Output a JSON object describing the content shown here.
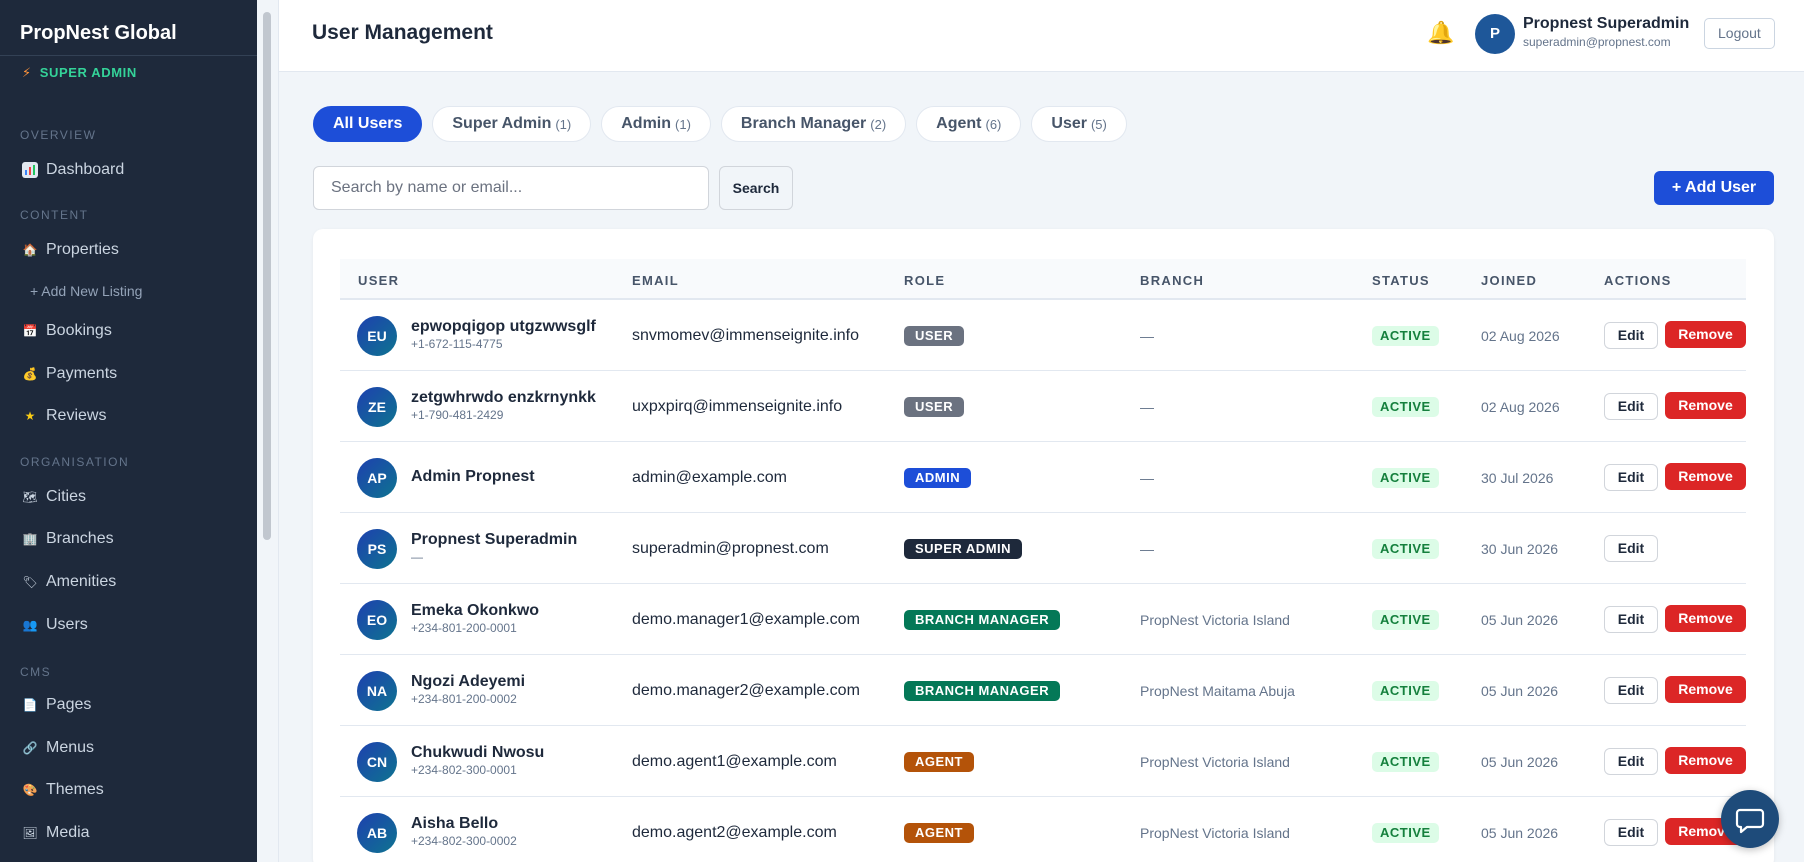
{
  "sidebar": {
    "brand": "PropNest Global",
    "role_tag": "SUPER ADMIN",
    "sections": {
      "overview": "OVERVIEW",
      "content": "CONTENT",
      "organisation": "ORGANISATION",
      "cms": "CMS"
    },
    "items": {
      "dashboard": "Dashboard",
      "properties": "Properties",
      "add_listing": "+ Add New Listing",
      "bookings": "Bookings",
      "payments": "Payments",
      "reviews": "Reviews",
      "cities": "Cities",
      "branches": "Branches",
      "amenities": "Amenities",
      "users": "Users",
      "pages": "Pages",
      "menus": "Menus",
      "themes": "Themes",
      "media": "Media"
    }
  },
  "header": {
    "title": "User Management",
    "user_initial": "P",
    "user_name": "Propnest Superadmin",
    "user_email": "superadmin@propnest.com",
    "logout_label": "Logout"
  },
  "tabs": [
    {
      "label": "All Users",
      "count": ""
    },
    {
      "label": "Super Admin",
      "count": "(1)"
    },
    {
      "label": "Admin",
      "count": "(1)"
    },
    {
      "label": "Branch Manager",
      "count": "(2)"
    },
    {
      "label": "Agent",
      "count": "(6)"
    },
    {
      "label": "User",
      "count": "(5)"
    }
  ],
  "search": {
    "placeholder": "Search by name or email...",
    "value": "",
    "button_label": "Search"
  },
  "add_user_label": "+ Add User",
  "table": {
    "columns": {
      "user": "USER",
      "email": "EMAIL",
      "role": "ROLE",
      "branch": "BRANCH",
      "status": "STATUS",
      "joined": "JOINED",
      "actions": "ACTIONS"
    },
    "edit_label": "Edit",
    "remove_label": "Remove",
    "rows": [
      {
        "initials": "EU",
        "name": "epwopqigop utgzwwsglf",
        "phone": "+1-672-115-4775",
        "email": "snvmomev@immenseignite.info",
        "role": "USER",
        "branch": "—",
        "status": "ACTIVE",
        "joined": "02 Aug 2026"
      },
      {
        "initials": "ZE",
        "name": "zetgwhrwdo enzkrnynkk",
        "phone": "+1-790-481-2429",
        "email": "uxpxpirq@immenseignite.info",
        "role": "USER",
        "branch": "—",
        "status": "ACTIVE",
        "joined": "02 Aug 2026"
      },
      {
        "initials": "AP",
        "name": "Admin Propnest",
        "phone": "",
        "email": "admin@example.com",
        "role": "ADMIN",
        "branch": "—",
        "status": "ACTIVE",
        "joined": "30 Jul 2026"
      },
      {
        "initials": "PS",
        "name": "Propnest Superadmin",
        "phone": "—",
        "email": "superadmin@propnest.com",
        "role": "SUPER ADMIN",
        "branch": "—",
        "status": "ACTIVE",
        "joined": "30 Jun 2026"
      },
      {
        "initials": "EO",
        "name": "Emeka Okonkwo",
        "phone": "+234-801-200-0001",
        "email": "demo.manager1@example.com",
        "role": "BRANCH MANAGER",
        "branch": "PropNest Victoria Island",
        "status": "ACTIVE",
        "joined": "05 Jun 2026"
      },
      {
        "initials": "NA",
        "name": "Ngozi Adeyemi",
        "phone": "+234-801-200-0002",
        "email": "demo.manager2@example.com",
        "role": "BRANCH MANAGER",
        "branch": "PropNest Maitama Abuja",
        "status": "ACTIVE",
        "joined": "05 Jun 2026"
      },
      {
        "initials": "CN",
        "name": "Chukwudi Nwosu",
        "phone": "+234-802-300-0001",
        "email": "demo.agent1@example.com",
        "role": "AGENT",
        "branch": "PropNest Victoria Island",
        "status": "ACTIVE",
        "joined": "05 Jun 2026"
      },
      {
        "initials": "AB",
        "name": "Aisha Bello",
        "phone": "+234-802-300-0002",
        "email": "demo.agent2@example.com",
        "role": "AGENT",
        "branch": "PropNest Victoria Island",
        "status": "ACTIVE",
        "joined": "05 Jun 2026"
      }
    ]
  },
  "colors": {
    "primary": "#1d4ed8",
    "sidebar_bg": "#1e293b",
    "role_user": "#6b7280",
    "role_admin": "#1d4ed8",
    "role_super_admin": "#1e293b",
    "role_branch_manager": "#047857",
    "role_agent": "#b45309",
    "remove": "#dc2626",
    "status_active_bg": "#dcfce7",
    "status_active_text": "#15803d"
  },
  "icons": {
    "dashboard": "bar-chart-icon",
    "properties": "house-icon",
    "bookings": "calendar-icon",
    "payments": "money-bag-icon",
    "reviews": "star-icon",
    "cities": "map-icon",
    "branches": "building-icon",
    "amenities": "tag-icon",
    "users": "users-icon",
    "pages": "page-icon",
    "menus": "link-icon",
    "themes": "palette-icon",
    "media": "image-icon",
    "notifications": "bell-icon",
    "chat": "chat-icon"
  }
}
